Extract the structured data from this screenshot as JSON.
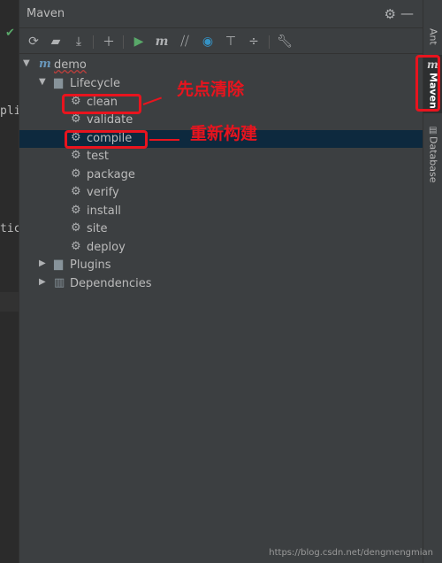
{
  "editor": {
    "frag1": "pli",
    "frag2": "tic"
  },
  "panel": {
    "title": "Maven"
  },
  "icons": {
    "settings": "gear-icon",
    "minimize": "minimize-icon",
    "reimport": "reimport-icon",
    "generate_sources": "generate-sources-icon",
    "download": "download-icon",
    "add": "add-icon",
    "run": "run-icon",
    "execute_goal": "maven-goal-icon",
    "skip_tests": "skip-tests-icon",
    "offline": "offline-icon",
    "show_deps": "show-dependencies-icon",
    "collapse": "collapse-all-icon",
    "maven_settings": "wrench-icon"
  },
  "tree": {
    "project": "demo",
    "lifecycle": "Lifecycle",
    "goals": [
      "clean",
      "validate",
      "compile",
      "test",
      "package",
      "verify",
      "install",
      "site",
      "deploy"
    ],
    "plugins": "Plugins",
    "dependencies": "Dependencies"
  },
  "sidebar": {
    "ant": "Ant",
    "maven": "Maven",
    "database": "Database"
  },
  "annotations": {
    "first": "先点清除",
    "second": "重新构建"
  },
  "colors": {
    "annotation": "#e8141e",
    "selection": "#0d293e",
    "run": "#59a869"
  },
  "watermark": "https://blog.csdn.net/dengmengmian"
}
